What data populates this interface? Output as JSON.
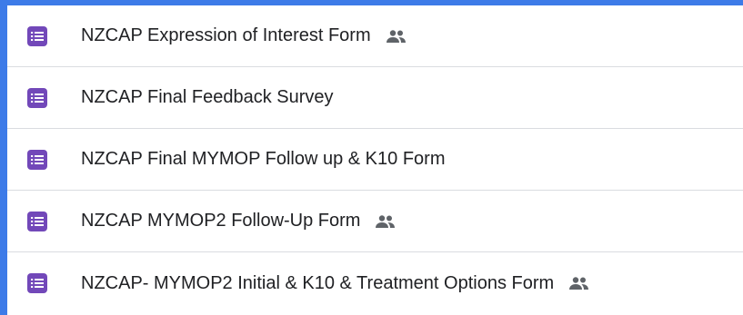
{
  "colors": {
    "frame_border": "#3d7be8",
    "form_icon": "#7248b9",
    "text": "#202124",
    "divider": "#dadce0",
    "shared_icon": "#5f6368"
  },
  "forms": [
    {
      "title": "NZCAP Expression of Interest Form",
      "shared": true,
      "icon": "forms-icon"
    },
    {
      "title": "NZCAP Final Feedback Survey",
      "shared": false,
      "icon": "forms-icon"
    },
    {
      "title": "NZCAP Final MYMOP Follow up & K10 Form",
      "shared": false,
      "icon": "forms-icon"
    },
    {
      "title": "NZCAP MYMOP2 Follow-Up Form",
      "shared": true,
      "icon": "forms-icon"
    },
    {
      "title": "NZCAP- MYMOP2 Initial & K10 & Treatment Options Form",
      "shared": true,
      "icon": "forms-icon"
    }
  ]
}
